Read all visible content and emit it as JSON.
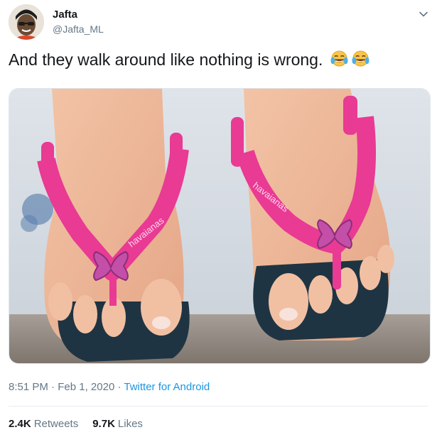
{
  "author": {
    "name": "Jafta",
    "handle": "@Jafta_ML"
  },
  "tweet": {
    "text": "And they walk around like nothing is wrong.",
    "emojis": [
      "face-with-tears-of-joy-icon",
      "face-with-tears-of-joy-icon"
    ]
  },
  "media": {
    "brand_text": "havaianas"
  },
  "meta": {
    "time": "8:51 PM",
    "separator": "·",
    "date": "Feb 1, 2020",
    "source": "Twitter for Android"
  },
  "stats": {
    "retweets_count": "2.4K",
    "retweets_label": "Retweets",
    "likes_count": "9.7K",
    "likes_label": "Likes"
  },
  "colors": {
    "link": "#1b95e0",
    "secondary_text": "#657786",
    "sandal_pink": "#e93a94",
    "sole_navy": "#1f3442"
  }
}
